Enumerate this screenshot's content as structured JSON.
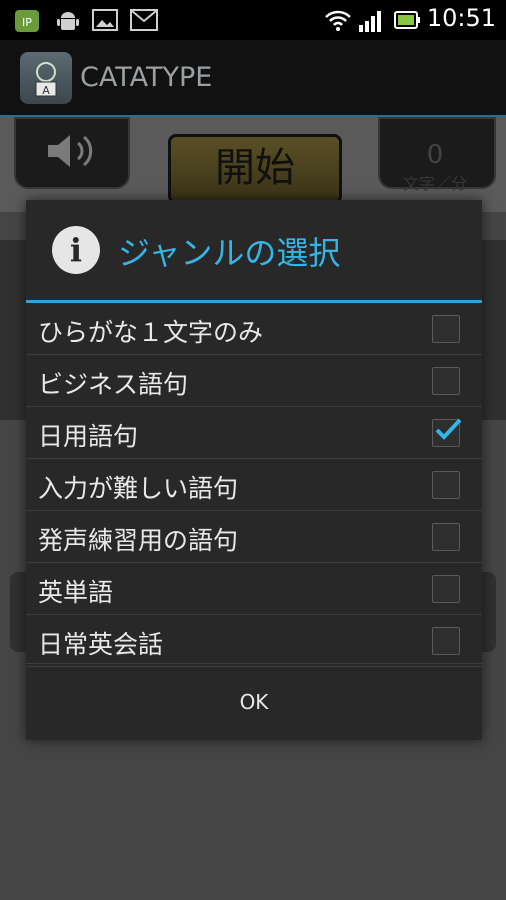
{
  "status_bar": {
    "time": "10:51",
    "icons": [
      "app-notification-icon",
      "android-icon",
      "image-icon",
      "gmail-icon",
      "wifi-icon",
      "signal-icon",
      "battery-icon"
    ]
  },
  "action_bar": {
    "title": "CATATYPE",
    "icon": "catatype-app-icon"
  },
  "background": {
    "start_label": "開始",
    "counter_value": "0",
    "counter_unit": "文字／分",
    "sound_icon": "speaker-icon"
  },
  "dialog": {
    "title": "ジャンルの選択",
    "icon": "info-icon",
    "items": [
      {
        "label": "ひらがな１文字のみ",
        "checked": false
      },
      {
        "label": "ビジネス語句",
        "checked": false
      },
      {
        "label": "日用語句",
        "checked": true
      },
      {
        "label": "入力が難しい語句",
        "checked": false
      },
      {
        "label": "発声練習用の語句",
        "checked": false
      },
      {
        "label": "英単語",
        "checked": false
      },
      {
        "label": "日常英会話",
        "checked": false
      }
    ],
    "ok_label": "OK"
  },
  "colors": {
    "accent": "#33b5e5",
    "dialog_bg": "#282828",
    "divider": "#33a4d2",
    "check": "#33b5e5"
  }
}
